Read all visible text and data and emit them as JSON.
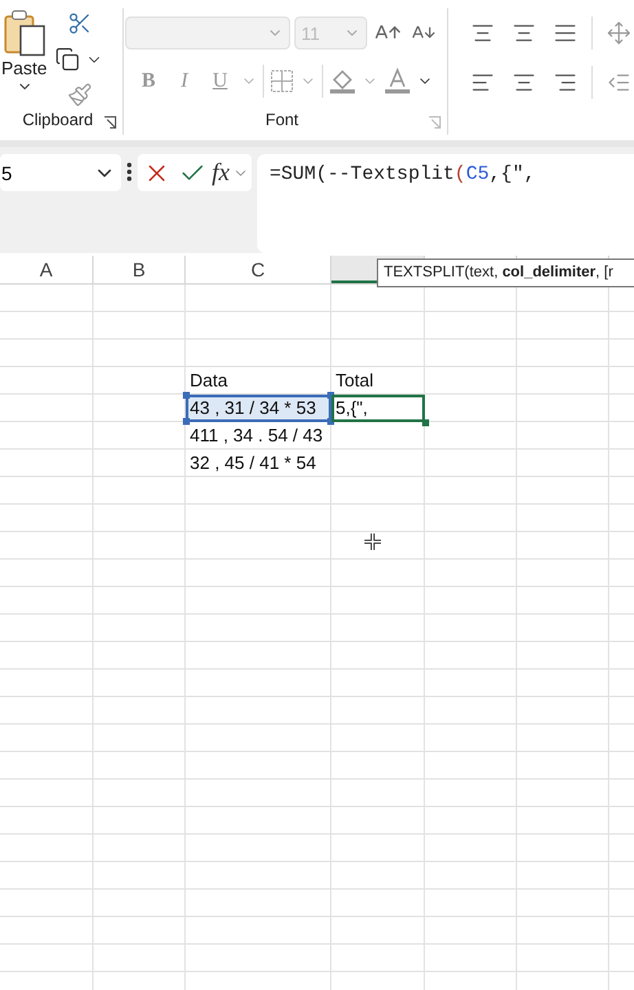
{
  "ribbon": {
    "clipboard": {
      "paste_label": "Paste",
      "group_label": "Clipboard"
    },
    "font": {
      "font_name": {
        "disabled": true
      },
      "font_size": {
        "value": "11",
        "disabled": true
      },
      "bold": "B",
      "italic": "I",
      "underline": "U",
      "group_label": "Font"
    }
  },
  "formula_bar": {
    "name_box": "5",
    "fx": "fx",
    "formula": [
      {
        "text": "=SUM(--Textsplit",
        "kind": "plain"
      },
      {
        "text": "(",
        "kind": "paren"
      },
      {
        "text": "C5",
        "kind": "reference"
      },
      {
        "text": ",{\",",
        "kind": "plain"
      }
    ]
  },
  "columns": [
    {
      "label": "A",
      "selected": false
    },
    {
      "label": "B",
      "selected": false
    },
    {
      "label": "C",
      "selected": false
    },
    {
      "selected": true
    }
  ],
  "tooltip": "TEXTSPLIT(text, **col_delimiter**, [r",
  "table": {
    "header": {
      "data": "Data",
      "total": "Total"
    },
    "rows": [
      {
        "data": {
          "text": "43 , 31 / 34 * 53",
          "referenced": true
        },
        "total": {
          "text": "5,{\",",
          "active": true
        }
      },
      {
        "data": {
          "text": "411 , 34 . 54 / 43",
          "referenced": false
        }
      },
      {
        "data": {
          "text": "32 , 45 / 41 * 54",
          "referenced": false
        }
      }
    ]
  }
}
